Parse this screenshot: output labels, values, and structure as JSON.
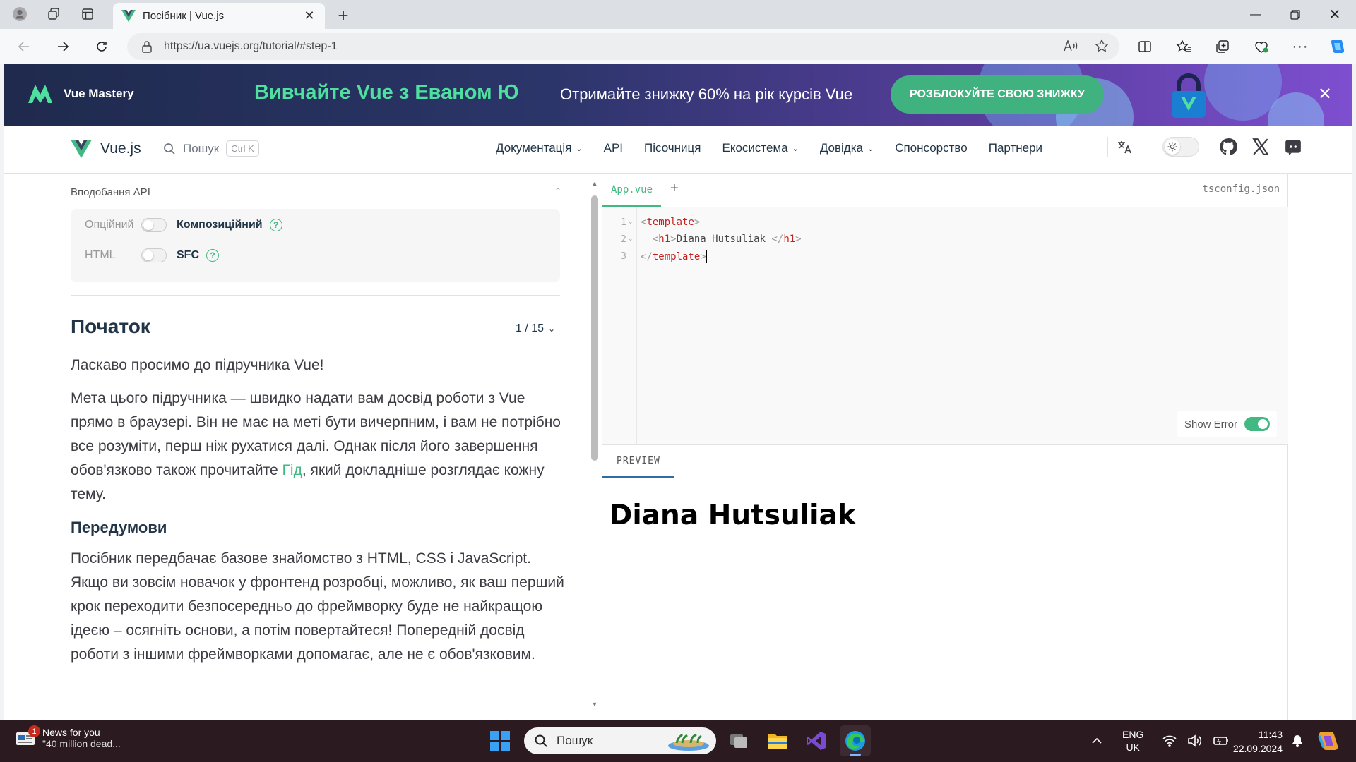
{
  "browser": {
    "tab_title": "Посібник | Vue.js",
    "url": "https://ua.vuejs.org/tutorial/#step-1"
  },
  "banner": {
    "brand": "Vue Mastery",
    "title": "Вивчайте Vue з Еваном Ю",
    "subtitle": "Отримайте знижку 60% на рік курсів Vue",
    "cta": "РОЗБЛОКУЙТЕ СВОЮ ЗНИЖКУ"
  },
  "header": {
    "brand": "Vue.js",
    "search_placeholder": "Пошук",
    "search_shortcut": "Ctrl K",
    "nav": [
      {
        "label": "Документація",
        "dropdown": true
      },
      {
        "label": "API",
        "dropdown": false
      },
      {
        "label": "Пісочниця",
        "dropdown": false
      },
      {
        "label": "Екосистема",
        "dropdown": true
      },
      {
        "label": "Довідка",
        "dropdown": true
      },
      {
        "label": "Спонсорство",
        "dropdown": false
      },
      {
        "label": "Партнери",
        "dropdown": false
      }
    ]
  },
  "preferences": {
    "title": "Вподобання API",
    "rows": [
      {
        "off": "Опційний",
        "on": "Композиційний"
      },
      {
        "off": "HTML",
        "on": "SFC"
      }
    ],
    "help": "?"
  },
  "tutorial": {
    "title": "Початок",
    "step": "1 / 15",
    "p1": "Ласкаво просимо до підручника Vue!",
    "p2_before": "Мета цього підручника — швидко надати вам досвід роботи з Vue прямо в браузері. Він не має на меті бути вичерпним, і вам не потрібно все розуміти, перш ніж рухатися далі. Однак після його завершення обов'язково також прочитайте ",
    "p2_link": "Гід",
    "p2_after": ", який докладніше розглядає кожну тему.",
    "h_prereq": "Передумови",
    "p3": "Посібник передбачає базове знайомство з HTML, CSS і JavaScript. Якщо ви зовсім новачок у фронтенд розробці, можливо, як ваш перший крок переходити безпосередньо до фреймворку буде не найкращою ідеєю – осягніть основи, а потім повертайтеся! Попередній досвід роботи з іншими фреймворками допомагає, але не є обов'язковим."
  },
  "editor": {
    "active_tab": "App.vue",
    "add_tab": "+",
    "right_tab": "tsconfig.json",
    "line_numbers": [
      "1",
      "2",
      "3"
    ],
    "line1_tag": "template",
    "line2_tag": "h1",
    "line2_text": "Diana Hutsuliak ",
    "line3_tag": "template",
    "show_error_label": "Show Error",
    "preview_tab": "PREVIEW",
    "preview_heading": "Diana Hutsuliak"
  },
  "taskbar": {
    "news_title": "News for you",
    "news_sub": "\"40 million dead...",
    "news_badge": "1",
    "search_placeholder": "Пошук",
    "lang_top": "ENG",
    "lang_bottom": "UK",
    "time": "11:43",
    "date": "22.09.2024"
  },
  "colors": {
    "vue_green": "#42b883",
    "banner_green": "#4fe0a0",
    "text_dark": "#213547",
    "taskbar_bg": "#2b1a1f"
  }
}
